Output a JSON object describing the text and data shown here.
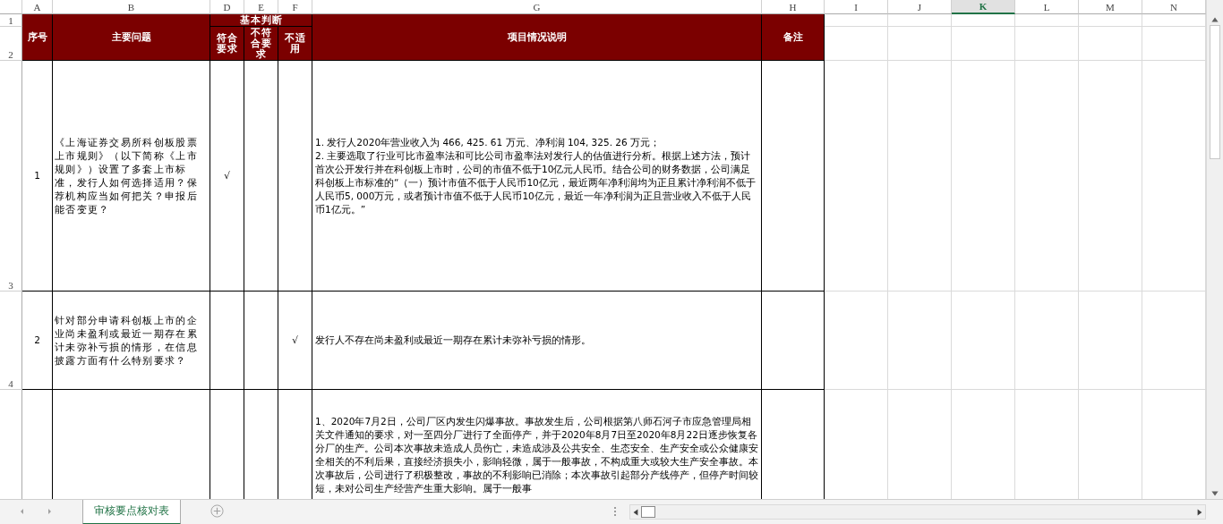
{
  "column_headers": [
    {
      "label": "A",
      "selected": false
    },
    {
      "label": "B",
      "selected": false
    },
    {
      "label": "D",
      "selected": false
    },
    {
      "label": "E",
      "selected": false
    },
    {
      "label": "F",
      "selected": false
    },
    {
      "label": "G",
      "selected": false
    },
    {
      "label": "H",
      "selected": false
    },
    {
      "label": "I",
      "selected": false
    },
    {
      "label": "J",
      "selected": false
    },
    {
      "label": "K",
      "selected": true
    },
    {
      "label": "L",
      "selected": false
    },
    {
      "label": "M",
      "selected": false
    },
    {
      "label": "N",
      "selected": false
    }
  ],
  "row_headers": [
    "1",
    "2",
    "3",
    "4"
  ],
  "table_header": {
    "number": "序号",
    "question": "主要问题",
    "judgment_group": "基本判断",
    "judgments": [
      "符合要求",
      "不符合要求",
      "不适用"
    ],
    "description": "项目情况说明",
    "remarks": "备注"
  },
  "rows": [
    {
      "number": "1",
      "question": "《上海证券交易所科创板股票上市规则》（以下简称《上市规则》）设置了多套上市标准，发行人如何选择适用？保荐机构应当如何把关？申报后能否变更？",
      "judgment_checked": [
        true,
        false,
        false
      ],
      "check": "√",
      "description": [
        "1. 发行人2020年营业收入为 466, 425. 61 万元、净利润 104, 325. 26 万元；",
        "2. 主要选取了行业可比市盈率法和可比公司市盈率法对发行人的估值进行分析。根据上述方法，预计首次公开发行并在科创板上市时，公司的市值不低于10亿元人民币。结合公司的财务数据，公司满足科创板上市标准的“（一）预计市值不低于人民币10亿元，最近两年净利润均为正且累计净利润不低于人民币5, 000万元，或者预计市值不低于人民币10亿元，最近一年净利润为正且营业收入不低于人民币1亿元。”"
      ]
    },
    {
      "number": "2",
      "question": "针对部分申请科创板上市的企业尚未盈利或最近一期存在累计未弥补亏损的情形，在信息披露方面有什么特别要求？",
      "judgment_checked": [
        false,
        false,
        true
      ],
      "check": "√",
      "description": [
        "发行人不存在尚未盈利或最近一期存在累计未弥补亏损的情形。"
      ]
    },
    {
      "description": [
        "1、2020年7月2日，公司厂区内发生闪爆事故。事故发生后，公司根据第八师石河子市应急管理局相关文件通知的要求，对一至四分厂进行了全面停产，并于2020年8月7日至2020年8月22日逐步恢复各分厂的生产。公司本次事故未造成人员伤亡，未造成涉及公共安全、生态安全、生产安全或公众健康安全相关的不利后果，直接经济损失小，影响轻微，属于一般事故，不构成重大或较大生产安全事故。本次事故后，公司进行了积极整改，事故的不利影响已消除；本次事故引起部分产线停产，但停产时间较短，未对公司生产经营产生重大影响。属于一般事"
      ]
    }
  ],
  "sheet_tabs": [
    {
      "label": "审核要点核对表",
      "selected": true
    }
  ]
}
